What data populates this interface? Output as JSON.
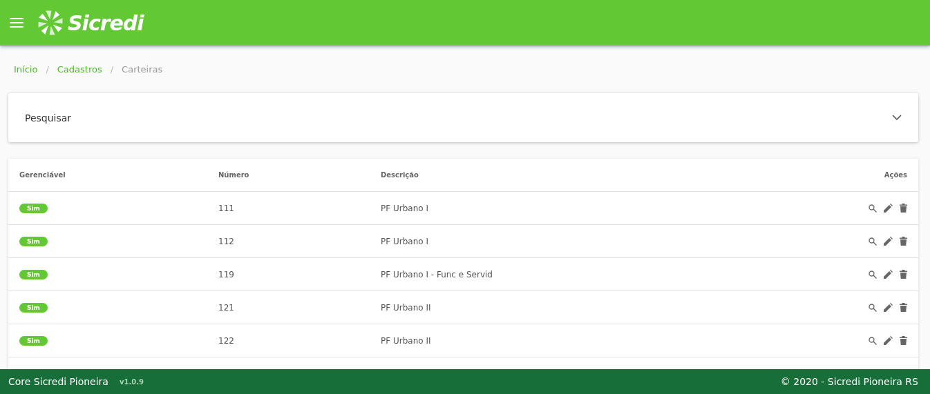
{
  "header": {
    "brand": "Sicredi"
  },
  "breadcrumb": {
    "links": [
      "Início",
      "Cadastros"
    ],
    "separators": [
      "/",
      "/"
    ],
    "current": "Carteiras"
  },
  "search_panel": {
    "title": "Pesquisar",
    "expanded": false
  },
  "table": {
    "columns": [
      "Gerenciável",
      "Número",
      "Descrição",
      "Ações"
    ],
    "rows": [
      {
        "gerenciavel": "Sim",
        "numero": "111",
        "descricao": "PF Urbano I"
      },
      {
        "gerenciavel": "Sim",
        "numero": "112",
        "descricao": "PF Urbano I"
      },
      {
        "gerenciavel": "Sim",
        "numero": "119",
        "descricao": "PF Urbano I - Func e Servid"
      },
      {
        "gerenciavel": "Sim",
        "numero": "121",
        "descricao": "PF Urbano II"
      },
      {
        "gerenciavel": "Sim",
        "numero": "122",
        "descricao": "PF Urbano II"
      }
    ]
  },
  "footer": {
    "app": "Core Sicredi Pioneira",
    "version": "v1.0.9",
    "copyright": "© 2020 - Sicredi Pioneira RS"
  }
}
